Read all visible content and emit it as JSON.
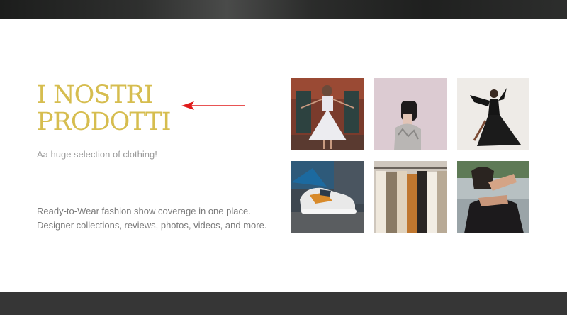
{
  "header": {
    "background": "#2b2c2b"
  },
  "hero": {
    "title_line1": "I NOSTRI",
    "title_line2": "PRODOTTI",
    "title_color": "#d6bd4f",
    "subtitle": "Aa huge selection of clothing!",
    "description": "Ready-to-Wear fashion show coverage in one place. Designer collections, reviews, photos, videos, and more."
  },
  "gallery": {
    "images": [
      {
        "icon": "woman-white-dress-photo"
      },
      {
        "icon": "woman-bob-hair-photo"
      },
      {
        "icon": "woman-black-gown-photo"
      },
      {
        "icon": "sneaker-photo"
      },
      {
        "icon": "clothing-rack-photo"
      },
      {
        "icon": "woman-hands-face-photo"
      }
    ]
  },
  "annotation": {
    "arrow_color": "#e01b1b"
  },
  "footer": {
    "background": "#363636"
  }
}
